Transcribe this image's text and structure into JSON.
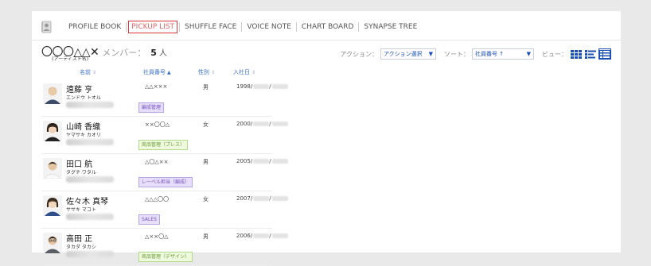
{
  "nav": {
    "items": [
      {
        "label": "PROFILE BOOK",
        "active": false
      },
      {
        "label": "PICKUP LIST",
        "active": true
      },
      {
        "label": "SHUFFLE FACE",
        "active": false
      },
      {
        "label": "VOICE NOTE",
        "active": false
      },
      {
        "label": "CHART BOARD",
        "active": false
      },
      {
        "label": "SYNAPSE TREE",
        "active": false
      }
    ]
  },
  "header": {
    "group_name": "〇〇〇△△✕",
    "group_sub": "(アーティスト名)",
    "member_label": "メンバー：",
    "member_count": "5",
    "member_unit": "人"
  },
  "controls": {
    "action_label": "アクション：",
    "action_value": "アクション選択",
    "sort_label": "ソート：",
    "sort_value": "社員番号 ↑",
    "view_label": "ビュー：",
    "view_modes": [
      "grid-view-icon",
      "list-detail-view-icon",
      "table-view-icon"
    ],
    "active_view": "table-view-icon"
  },
  "table": {
    "headers": {
      "name": "名前",
      "code": "社員番号",
      "gender": "性別",
      "joined": "入社日"
    },
    "sorted_by": "code",
    "rows": [
      {
        "name": "遠藤 亨",
        "kana": "エンドウ トオル",
        "code": "△△×××",
        "gender": "男",
        "joined": "1998/",
        "joined_sep": "/",
        "tag": "編成管理",
        "tag_color": "purple"
      },
      {
        "name": "山崎 香織",
        "kana": "ヤマサキ カオリ",
        "code": "××〇〇△",
        "gender": "女",
        "joined": "2000/",
        "joined_sep": "/",
        "tag": "商品管理（プレス）",
        "tag_color": "green"
      },
      {
        "name": "田口 航",
        "kana": "タグチ ワタル",
        "code": "△〇△××",
        "gender": "男",
        "joined": "2005/",
        "joined_sep": "/",
        "tag": "レーベル担当（編成）",
        "tag_color": "purple"
      },
      {
        "name": "佐々木 真琴",
        "kana": "ササキ マコト",
        "code": "△△△〇〇",
        "gender": "女",
        "joined": "2007/",
        "joined_sep": "/",
        "tag": "SALES",
        "tag_color": "purple"
      },
      {
        "name": "高田 正",
        "kana": "タカダ タカシ",
        "code": "△××〇△",
        "gender": "男",
        "joined": "2006/",
        "joined_sep": "/",
        "tag": "商品管理（デザイン）",
        "tag_color": "green"
      }
    ]
  },
  "colors": {
    "accent": "#1a4fb5",
    "active_nav_border": "#e0353b",
    "header_link": "#3a6fc7"
  }
}
